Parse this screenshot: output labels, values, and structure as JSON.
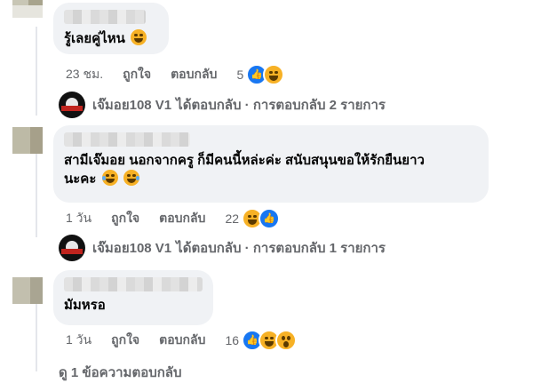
{
  "comments": [
    {
      "text": "รู้เลยคู่ไหน",
      "time": "23 ชม.",
      "like_label": "ถูกใจ",
      "reply_label": "ตอบกลับ",
      "reaction_count": "5",
      "reactions": [
        "like-icon",
        "haha-icon"
      ],
      "reply_summary": {
        "author": "เจ๊มอย108 V1",
        "text": "ได้ตอบกลับ · การตอบกลับ 2 รายการ"
      }
    },
    {
      "text": "สามีเจ๊มอย นอกจากครู ก็มีคนนี้หล่ะค่ะ สนับสนุนขอให้รักยืนยาว",
      "text_line2": "นะคะ",
      "time": "1 วัน",
      "like_label": "ถูกใจ",
      "reply_label": "ตอบกลับ",
      "reaction_count": "22",
      "reactions": [
        "haha-icon",
        "like-icon"
      ],
      "reply_summary": {
        "author": "เจ๊มอย108 V1",
        "text": "ได้ตอบกลับ · การตอบกลับ 1 รายการ"
      }
    },
    {
      "text": "มัมหรอ",
      "time": "1 วัน",
      "like_label": "ถูกใจ",
      "reply_label": "ตอบกลับ",
      "reaction_count": "16",
      "reactions": [
        "like-icon",
        "haha-icon",
        "wow-icon"
      ]
    }
  ],
  "view_more_replies": "ดู 1 ข้อความตอบกลับ",
  "colors": {
    "bubble": "#f0f2f5",
    "secondary_text": "#65676b",
    "like_blue": "#1877f2",
    "emoji_yellow": "#f7b125"
  }
}
